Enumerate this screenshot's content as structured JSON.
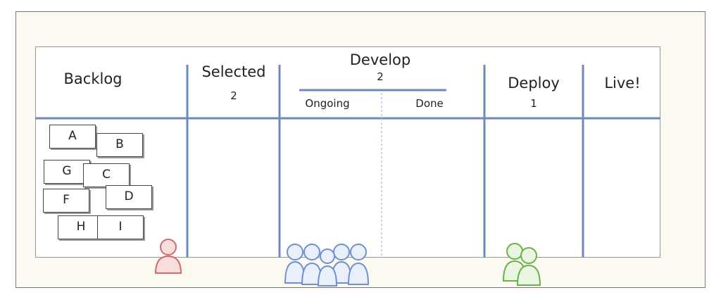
{
  "columns": {
    "backlog": {
      "title": "Backlog"
    },
    "selected": {
      "title": "Selected",
      "wip": "2"
    },
    "develop": {
      "title": "Develop",
      "wip": "2",
      "ongoing": "Ongoing",
      "done": "Done"
    },
    "deploy": {
      "title": "Deploy",
      "wip": "1"
    },
    "live": {
      "title": "Live!"
    }
  },
  "cards": [
    "A",
    "B",
    "G",
    "C",
    "F",
    "D",
    "H",
    "I"
  ],
  "colors": {
    "lines": "#6f88bf",
    "red_person": "#d46a6a",
    "blue_people": "#6f8fcf",
    "green_people": "#6ab04c"
  },
  "people_icons": [
    "person-icon-red",
    "people-group-icon-blue",
    "people-group-icon-green"
  ]
}
